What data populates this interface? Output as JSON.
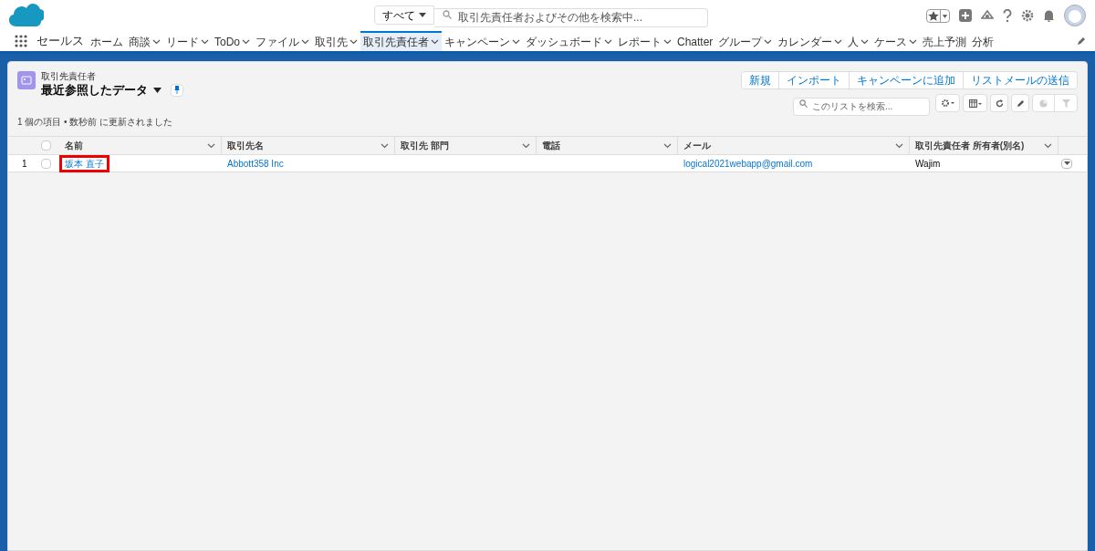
{
  "header": {
    "search_scope": "すべて",
    "search": {
      "placeholder": "取引先責任者およびその他を検索中..."
    }
  },
  "nav": {
    "app_name": "セールス",
    "items": [
      {
        "label": "ホーム",
        "menu": false,
        "selected": false
      },
      {
        "label": "商談",
        "menu": true,
        "selected": false
      },
      {
        "label": "リード",
        "menu": true,
        "selected": false
      },
      {
        "label": "ToDo",
        "menu": true,
        "selected": false
      },
      {
        "label": "ファイル",
        "menu": true,
        "selected": false
      },
      {
        "label": "取引先",
        "menu": true,
        "selected": false
      },
      {
        "label": "取引先責任者",
        "menu": true,
        "selected": true
      },
      {
        "label": "キャンペーン",
        "menu": true,
        "selected": false
      },
      {
        "label": "ダッシュボード",
        "menu": true,
        "selected": false
      },
      {
        "label": "レポート",
        "menu": true,
        "selected": false
      },
      {
        "label": "Chatter",
        "menu": false,
        "selected": false
      },
      {
        "label": "グループ",
        "menu": true,
        "selected": false
      },
      {
        "label": "カレンダー",
        "menu": true,
        "selected": false
      },
      {
        "label": "人",
        "menu": true,
        "selected": false
      },
      {
        "label": "ケース",
        "menu": true,
        "selected": false
      },
      {
        "label": "売上予測",
        "menu": false,
        "selected": false
      },
      {
        "label": "分析",
        "menu": false,
        "selected": false
      }
    ]
  },
  "list_view": {
    "object_label": "取引先責任者",
    "title": "最近参照したデータ",
    "status": "1 個の項目 • 数秒前 に更新されました",
    "buttons": [
      "新規",
      "インポート",
      "キャンペーンに追加",
      "リストメールの送信"
    ],
    "search": {
      "placeholder": "このリストを検索..."
    },
    "table": {
      "select_all_checked": false,
      "columns": [
        "名前",
        "取引先名",
        "取引先 部門",
        "電話",
        "メール",
        "取引先責任者 所有者(別名)"
      ],
      "rows": [
        {
          "number": "1",
          "checked": false,
          "highlighted": true,
          "cells": [
            "坂本 直子",
            "Abbott358 Inc",
            "",
            "",
            "logical2021webapp@gmail.com",
            "Wajim"
          ]
        }
      ]
    }
  }
}
